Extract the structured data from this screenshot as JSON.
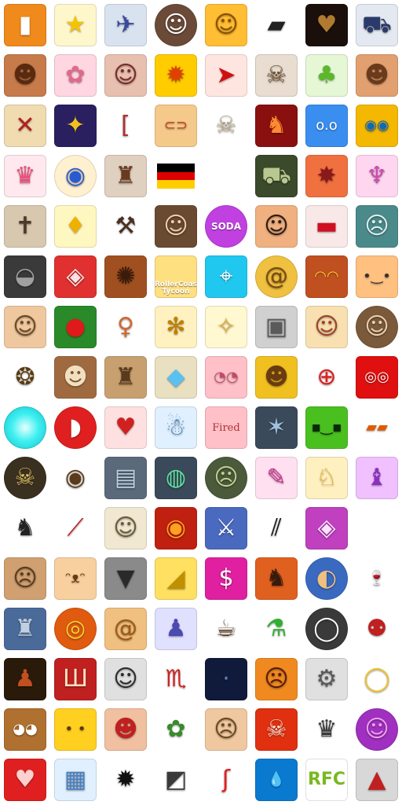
{
  "icons": [
    {
      "name": "walkie-talkie-icon",
      "bg": "#f08a1c",
      "glyph": "▮"
    },
    {
      "name": "smiling-star-icon",
      "bg": "#fff7cc",
      "glyph": "★",
      "color": "#f5c400"
    },
    {
      "name": "jet-fighter-icon",
      "bg": "#d9e3f0",
      "glyph": "✈",
      "color": "#3a4a9a"
    },
    {
      "name": "anime-girl-face-icon",
      "bg": "#6b4a38",
      "glyph": "☺",
      "round": true
    },
    {
      "name": "book-smiley-icon",
      "bg": "#ffbe33",
      "glyph": "☺",
      "color": "#8a5000"
    },
    {
      "name": "flashlight-icon",
      "bg": "#ffffff",
      "glyph": "▰",
      "color": "#222222",
      "plain": true
    },
    {
      "name": "demon-heart-icon",
      "bg": "#1a0f0a",
      "glyph": "♥",
      "color": "#b07a30"
    },
    {
      "name": "buggy-vehicle-icon",
      "bg": "#e4e8f0",
      "glyph": "⛟",
      "color": "#2a3a6a"
    },
    {
      "name": "pixel-man-face-icon",
      "bg": "#c77a4a",
      "glyph": "☻",
      "color": "#5a2a10"
    },
    {
      "name": "pink-bunny-icon",
      "bg": "#ffd6e2",
      "glyph": "✿",
      "color": "#e06a8a"
    },
    {
      "name": "anime-girl-face-icon",
      "bg": "#e8c0b0",
      "glyph": "☺",
      "color": "#7a2a2a"
    },
    {
      "name": "explosion-ball-icon",
      "bg": "#ffcc00",
      "glyph": "✹",
      "color": "#e04000"
    },
    {
      "name": "rocket-icon",
      "bg": "#ffe5e0",
      "glyph": "➤",
      "color": "#d01010"
    },
    {
      "name": "skull-crossbones-icon",
      "bg": "#e8ddd0",
      "glyph": "☠",
      "color": "#6a4a2a"
    },
    {
      "name": "green-tree-icon",
      "bg": "#e6f7d6",
      "glyph": "♣",
      "color": "#5ab82a"
    },
    {
      "name": "pixel-head-icon",
      "bg": "#e2a070",
      "glyph": "☻",
      "color": "#6a3a1a"
    },
    {
      "name": "treasure-map-icon",
      "bg": "#f0dcb0",
      "glyph": "✕",
      "color": "#b02020"
    },
    {
      "name": "space-ship-icon",
      "bg": "#2a2060",
      "glyph": "✦",
      "color": "#f0c020"
    },
    {
      "name": "bracket-icon",
      "bg": "#ffffff",
      "glyph": "[",
      "color": "#b03030",
      "plain": true
    },
    {
      "name": "hot-dog-icon",
      "bg": "#f5c98a",
      "glyph": "⊂⊃",
      "color": "#c04020"
    },
    {
      "name": "skeleton-icon",
      "bg": "#ffffff",
      "glyph": "☠",
      "color": "#b0a080",
      "plain": true
    },
    {
      "name": "red-demon-icon",
      "bg": "#8a1010",
      "glyph": "♞",
      "color": "#ff8a30"
    },
    {
      "name": "blue-robot-face-icon",
      "bg": "#3a8ef0",
      "glyph": "o.o",
      "color": "#ffffff"
    },
    {
      "name": "pilot-goggles-icon",
      "bg": "#f5b800",
      "glyph": "◉◉",
      "color": "#0a6ac0"
    },
    {
      "name": "pink-crown-outline-icon",
      "bg": "#ffe8ee",
      "glyph": "♛",
      "color": "#f04a7a"
    },
    {
      "name": "eyeball-icon",
      "bg": "#fff0d0",
      "glyph": "◉",
      "color": "#2a5ad0",
      "round": true
    },
    {
      "name": "robot-kid-icon",
      "bg": "#e0d0c0",
      "glyph": "♜",
      "color": "#6a3a20"
    },
    {
      "name": "germany-flag-icon",
      "flag": [
        "#000000",
        "#dd0000",
        "#ffce00"
      ]
    },
    {
      "name": "empty-slot-icon",
      "bg": "transparent",
      "glyph": "",
      "plain": true
    },
    {
      "name": "tank-icon",
      "bg": "#3a4a2a",
      "glyph": "⛟",
      "color": "#b8c890"
    },
    {
      "name": "pixel-monster-icon",
      "bg": "#f07040",
      "glyph": "✸",
      "color": "#8a1a1a"
    },
    {
      "name": "jellyfish-icon",
      "bg": "#ffd6f0",
      "glyph": "♆",
      "color": "#d04ab0"
    },
    {
      "name": "coffin-icon",
      "bg": "#d8c8b0",
      "glyph": "✝",
      "color": "#4a3a2a"
    },
    {
      "name": "pixel-bird-icon",
      "bg": "#fff7c0",
      "glyph": "♦",
      "color": "#f0b000"
    },
    {
      "name": "pickaxe-icon",
      "bg": "#ffffff",
      "glyph": "⚒",
      "color": "#4a3020",
      "plain": true
    },
    {
      "name": "adventurer-face-icon",
      "bg": "#6a4a30",
      "glyph": "☺",
      "color": "#f0d0b0"
    },
    {
      "name": "soda-cap-icon",
      "bg": "#c040e0",
      "glyph": "",
      "round": true,
      "text": "SODA"
    },
    {
      "name": "mustache-man-icon",
      "bg": "#f0b080",
      "glyph": "☺",
      "color": "#2a1a10"
    },
    {
      "name": "potion-jar-icon",
      "bg": "#f8e8e8",
      "glyph": "▬",
      "color": "#d01020"
    },
    {
      "name": "zombie-girl-icon",
      "bg": "#4a8a8a",
      "glyph": "☹",
      "color": "#e0f0f0"
    },
    {
      "name": "soldier-helmet-icon",
      "bg": "#3a3a3a",
      "glyph": "◒",
      "color": "#a0a0a0"
    },
    {
      "name": "red-robot-head-icon",
      "bg": "#e03030",
      "glyph": "◈",
      "color": "#ffe0e0"
    },
    {
      "name": "spiky-creature-icon",
      "bg": "#a05020",
      "glyph": "✺",
      "color": "#3a1a0a"
    },
    {
      "name": "rollercoaster-tycoon-logo-icon",
      "bg": "#ffe080",
      "glyph": "",
      "text": "RollerCoaster Tycoon",
      "textSize": "small"
    },
    {
      "name": "cyan-target-icon",
      "bg": "#20c8f0",
      "glyph": "⌖",
      "color": "#ffffff"
    },
    {
      "name": "gold-swirl-orb-icon",
      "bg": "#f0c040",
      "glyph": "@",
      "color": "#7a4a10",
      "round": true
    },
    {
      "name": "treasure-chest-face-icon",
      "bg": "#c05020",
      "glyph": "◠◠",
      "color": "#ffd030"
    },
    {
      "name": "orange-square-face-icon",
      "bg": "#ffc080",
      "glyph": "•‿•",
      "color": "#333333"
    },
    {
      "name": "blond-man-face-icon",
      "bg": "#f0c8a0",
      "glyph": "☺",
      "color": "#6a4a20"
    },
    {
      "name": "red-apple-icon",
      "bg": "#2a8a2a",
      "glyph": "●",
      "color": "#e01a1a"
    },
    {
      "name": "girl-sprite-icon",
      "bg": "#ffffff",
      "glyph": "♀",
      "color": "#d06a30",
      "plain": true
    },
    {
      "name": "wasp-icon",
      "bg": "#fff2c0",
      "glyph": "✻",
      "color": "#c08000"
    },
    {
      "name": "fairy-girl-icon",
      "bg": "#fff8d0",
      "glyph": "✧",
      "color": "#e0b040"
    },
    {
      "name": "gray-robot-icon",
      "bg": "#d0d0d0",
      "glyph": "▣",
      "color": "#5a5a5a"
    },
    {
      "name": "blonde-anime-girl-icon",
      "bg": "#f8e0b0",
      "glyph": "☺",
      "color": "#a0402a"
    },
    {
      "name": "woman-portrait-icon",
      "bg": "#7a5a3a",
      "glyph": "☺",
      "color": "#f0d0b0",
      "round": true
    },
    {
      "name": "brown-swirl-icon",
      "bg": "#ffffff",
      "glyph": "❂",
      "color": "#5a3a10",
      "plain": true
    },
    {
      "name": "pixel-nerd-face-icon",
      "bg": "#a06a40",
      "glyph": "☻",
      "color": "#f0e0c0"
    },
    {
      "name": "knight-helmet-icon",
      "bg": "#c8a070",
      "glyph": "♜",
      "color": "#5a3a1a"
    },
    {
      "name": "crystal-rock-icon",
      "bg": "#e8e0c0",
      "glyph": "◆",
      "color": "#5ac0f0"
    },
    {
      "name": "pig-face-icon",
      "bg": "#ffc0c8",
      "glyph": "◔◔",
      "color": "#c04a6a"
    },
    {
      "name": "pixel-boy-icon",
      "bg": "#f0c020",
      "glyph": "☻",
      "color": "#6a3a10"
    },
    {
      "name": "crosshair-icon",
      "bg": "#ffffff",
      "glyph": "⊕",
      "color": "#e02020",
      "plain": true
    },
    {
      "name": "red-ghost-icon",
      "bg": "#e01010",
      "glyph": "◎◎",
      "color": "#ffffff"
    },
    {
      "name": "cyan-glow-orb-icon",
      "bg": "#40f0f0",
      "glyph": "",
      "round": true
    },
    {
      "name": "race-helmet-icon",
      "bg": "#e02020",
      "glyph": "◗",
      "color": "#ffffff",
      "round": true
    },
    {
      "name": "ruby-heart-icon",
      "bg": "#ffe0e0",
      "glyph": "♥",
      "color": "#d02020"
    },
    {
      "name": "white-robot-icon",
      "bg": "#e0f0ff",
      "glyph": "☃",
      "color": "#4a8ac0"
    },
    {
      "name": "fired-note-icon",
      "bg": "#ffc0c8",
      "glyph": "",
      "text": "Fired",
      "textStyle": "hand"
    },
    {
      "name": "dark-gem-icon",
      "bg": "#3a4a5a",
      "glyph": "✶",
      "color": "#a0c0e0"
    },
    {
      "name": "green-block-face-icon",
      "bg": "#4ac020",
      "glyph": "▪‿▪",
      "color": "#0a2a0a"
    },
    {
      "name": "sunglasses-icon",
      "bg": "#ffffff",
      "glyph": "▰▰",
      "color": "#e05a00",
      "plain": true
    },
    {
      "name": "gold-skull-icon",
      "bg": "#3a3020",
      "glyph": "☠",
      "color": "#e0c060",
      "round": true
    },
    {
      "name": "eye-icon",
      "bg": "#ffffff",
      "glyph": "◉",
      "color": "#5a3a1a",
      "plain": true
    },
    {
      "name": "metal-chest-icon",
      "bg": "#5a6a7a",
      "glyph": "▤",
      "color": "#c0d0e0"
    },
    {
      "name": "robot-orb-icon",
      "bg": "#3a4a5a",
      "glyph": "◍",
      "color": "#60e0a0"
    },
    {
      "name": "warrior-portrait-icon",
      "bg": "#4a5a3a",
      "glyph": "☹",
      "color": "#c0d090",
      "round": true
    },
    {
      "name": "flame-brush-icon",
      "bg": "#ffe0f0",
      "glyph": "✎",
      "color": "#d03090"
    },
    {
      "name": "yellow-fox-icon",
      "bg": "#fff0c0",
      "glyph": "♘",
      "color": "#f0b020"
    },
    {
      "name": "purple-hat-creature-icon",
      "bg": "#f0c0ff",
      "glyph": "♝",
      "color": "#8a30c0"
    },
    {
      "name": "chess-knight-icon",
      "bg": "#ffffff",
      "glyph": "♞",
      "color": "#222222",
      "plain": true
    },
    {
      "name": "paddle-icon",
      "bg": "#ffffff",
      "glyph": "⟋",
      "color": "#c02020",
      "plain": true
    },
    {
      "name": "guy-fawkes-mask-icon",
      "bg": "#f0e8d0",
      "glyph": "☺",
      "color": "#6a5a3a"
    },
    {
      "name": "fire-eye-icon",
      "bg": "#c02010",
      "glyph": "◉",
      "color": "#ffa020"
    },
    {
      "name": "swords-battle-icon",
      "bg": "#4a6ac0",
      "glyph": "⚔",
      "color": "#ffffff"
    },
    {
      "name": "slash-marks-icon",
      "bg": "#ffffff",
      "glyph": "⫽",
      "color": "#111111",
      "plain": true
    },
    {
      "name": "purple-gem-face-icon",
      "bg": "#c040c0",
      "glyph": "◈",
      "color": "#ffe0ff"
    },
    {
      "name": "empty-slot-icon",
      "bg": "transparent",
      "glyph": "",
      "plain": true
    },
    {
      "name": "bulldog-icon",
      "bg": "#d0a070",
      "glyph": "☹",
      "color": "#5a3a20"
    },
    {
      "name": "cat-face-icon",
      "bg": "#f8d0a0",
      "glyph": "ᵔᴥᵔ",
      "color": "#6a3a10"
    },
    {
      "name": "drill-bit-icon",
      "bg": "#8a8a8a",
      "glyph": "▼",
      "color": "#2a2a2a"
    },
    {
      "name": "cheese-icon",
      "bg": "#ffe060",
      "glyph": "◢",
      "color": "#c09000"
    },
    {
      "name": "dollar-shield-icon",
      "bg": "#e020a0",
      "glyph": "$",
      "color": "#ffffff"
    },
    {
      "name": "red-panda-icon",
      "bg": "#e06020",
      "glyph": "♞",
      "color": "#3a1a0a"
    },
    {
      "name": "planet-shovel-icon",
      "bg": "#3a6ac0",
      "glyph": "◐",
      "color": "#f0c080",
      "round": true
    },
    {
      "name": "wine-glass-icon",
      "bg": "#ffffff",
      "glyph": "🍷",
      "color": "#7a1020",
      "plain": true
    },
    {
      "name": "blue-mech-icon",
      "bg": "#4a6a9a",
      "glyph": "♜",
      "color": "#c0d0e0"
    },
    {
      "name": "spinning-top-icon",
      "bg": "#e05a10",
      "glyph": "◎",
      "color": "#ffd030",
      "round": true
    },
    {
      "name": "snail-shell-icon",
      "bg": "#f0c080",
      "glyph": "@",
      "color": "#a05a10"
    },
    {
      "name": "anime-swordsman-icon",
      "bg": "#e0e0ff",
      "glyph": "♟",
      "color": "#4a4ab0"
    },
    {
      "name": "coffee-cup-icon",
      "bg": "#ffffff",
      "glyph": "☕",
      "color": "#5a3a1a",
      "plain": true
    },
    {
      "name": "green-potion-icon",
      "bg": "#ffffff",
      "glyph": "⚗",
      "color": "#30b030",
      "plain": true
    },
    {
      "name": "computer-mouse-icon",
      "bg": "#3a3a3a",
      "glyph": "◯",
      "color": "#ffffff",
      "round": true
    },
    {
      "name": "tripod-robot-icon",
      "bg": "#ffffff",
      "glyph": "⚉",
      "color": "#c02020",
      "plain": true
    },
    {
      "name": "shadow-figure-icon",
      "bg": "#2a1a0a",
      "glyph": "♟",
      "color": "#c05020"
    },
    {
      "name": "shield-swords-icon",
      "bg": "#c02020",
      "glyph": "Ш",
      "color": "#ffe0c0"
    },
    {
      "name": "white-hair-girl-icon",
      "bg": "#e0e0e0",
      "glyph": "☺",
      "color": "#2a2a2a"
    },
    {
      "name": "red-scorpion-icon",
      "bg": "#ffffff",
      "glyph": "♏",
      "color": "#d02020",
      "plain": true
    },
    {
      "name": "dark-space-icon",
      "bg": "#101a3a",
      "glyph": "·",
      "color": "#6080c0"
    },
    {
      "name": "angry-mask-icon",
      "bg": "#f08a20",
      "glyph": "☹",
      "color": "#5a1a0a"
    },
    {
      "name": "wheeled-robot-icon",
      "bg": "#e0e0e0",
      "glyph": "⚙",
      "color": "#5a5a5a"
    },
    {
      "name": "gold-ring-icon",
      "bg": "#ffffff",
      "glyph": "◯",
      "color": "#f0c020",
      "plain": true
    },
    {
      "name": "wood-block-face-icon",
      "bg": "#b07030",
      "glyph": "◕◕",
      "color": "#ffffff"
    },
    {
      "name": "yellow-square-face-icon",
      "bg": "#ffd020",
      "glyph": "• •",
      "color": "#5a3a00"
    },
    {
      "name": "pixel-pirate-icon",
      "bg": "#f0c0a0",
      "glyph": "☻",
      "color": "#c02020"
    },
    {
      "name": "potted-plant-icon",
      "bg": "#ffffff",
      "glyph": "✿",
      "color": "#3a8a2a",
      "plain": true
    },
    {
      "name": "blond-tough-guy-icon",
      "bg": "#f0c8a0",
      "glyph": "☹",
      "color": "#6a4a20"
    },
    {
      "name": "red-skull-icon",
      "bg": "#e03010",
      "glyph": "☠",
      "color": "#ffe0d0"
    },
    {
      "name": "black-crown-icon",
      "bg": "#ffffff",
      "glyph": "♛",
      "color": "#3a3a3a",
      "plain": true
    },
    {
      "name": "purple-face-badge-icon",
      "bg": "#a030c0",
      "glyph": "☺",
      "color": "#f0a0f0",
      "round": true
    },
    {
      "name": "heart-face-icon",
      "bg": "#e02020",
      "glyph": "♥",
      "color": "#ffd0d0"
    },
    {
      "name": "gift-building-icon",
      "bg": "#e0f0ff",
      "glyph": "▦",
      "color": "#4a80c0"
    },
    {
      "name": "black-sunburst-icon",
      "bg": "#ffffff",
      "glyph": "✹",
      "color": "#111111",
      "plain": true
    },
    {
      "name": "film-camera-icon",
      "bg": "#ffffff",
      "glyph": "◩",
      "color": "#3a3a3a",
      "plain": true
    },
    {
      "name": "candy-cane-icon",
      "bg": "#ffffff",
      "glyph": "ʃ",
      "color": "#e02020",
      "plain": true
    },
    {
      "name": "water-drop-icon",
      "bg": "#0a7ad0",
      "glyph": "💧",
      "color": "#ffffff"
    },
    {
      "name": "rfc-logo-icon",
      "bg": "#ffffff",
      "glyph": "",
      "text": "RFC",
      "textStyle": "big",
      "textColor": "#7ab820"
    },
    {
      "name": "red-triangle-logo-icon",
      "bg": "#d8d8d8",
      "glyph": "▲",
      "color": "#c02020"
    }
  ]
}
